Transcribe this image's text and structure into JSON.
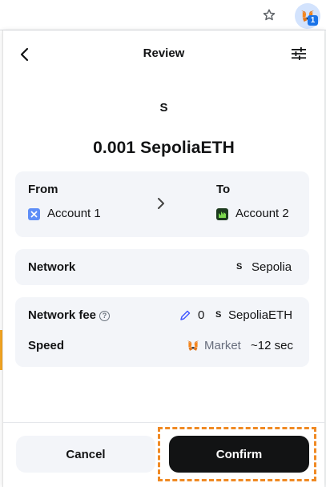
{
  "header": {
    "title": "Review",
    "back_icon": "chevron-left-icon",
    "settings_icon": "sliders-icon"
  },
  "token": {
    "avatar_letter": "S",
    "amount": "0.001 SepoliaETH"
  },
  "transfer": {
    "from_label": "From",
    "from_account": "Account 1",
    "to_label": "To",
    "to_account": "Account 2"
  },
  "network": {
    "label": "Network",
    "icon_letter": "S",
    "value": "Sepolia"
  },
  "fee": {
    "label": "Network fee",
    "info_icon": "?",
    "amount": "0",
    "currency_icon_letter": "S",
    "currency": "SepoliaETH",
    "speed_label": "Speed",
    "speed_mode": "Market",
    "speed_time": "~12 sec"
  },
  "actions": {
    "cancel": "Cancel",
    "confirm": "Confirm"
  },
  "browser": {
    "extension_badge": "1"
  },
  "colors": {
    "card_bg": "#f3f5f9",
    "confirm_bg": "#121314",
    "highlight": "#f08a24",
    "account1_icon": "#5e8ef7",
    "account2_icon": "#1d3b1f",
    "pencil": "#4459ff"
  }
}
